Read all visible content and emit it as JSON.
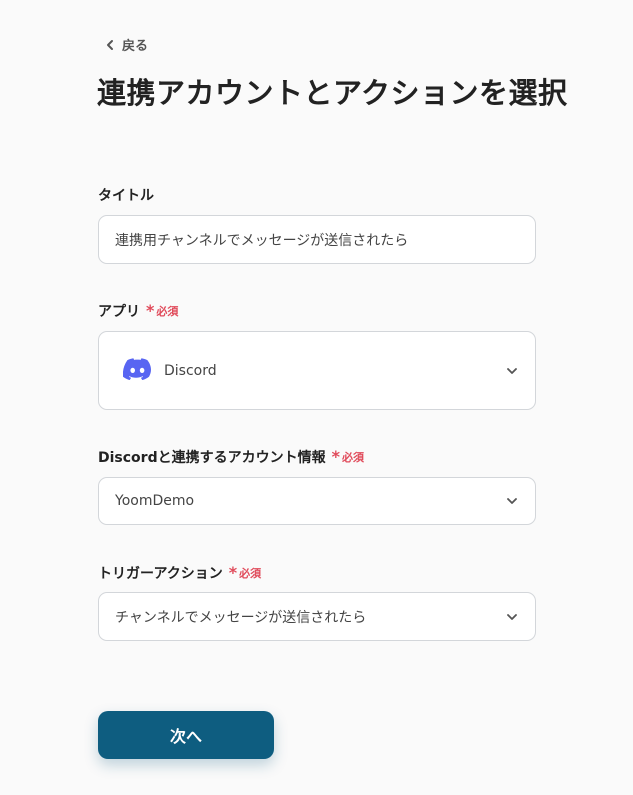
{
  "back_label": "戻る",
  "page_title": "連携アカウントとアクションを選択",
  "required_label": "必須",
  "required_mark": "*",
  "fields": {
    "title": {
      "label": "タイトル",
      "value": "連携用チャンネルでメッセージが送信されたら"
    },
    "app": {
      "label": "アプリ",
      "value": "Discord",
      "icon": "discord-logo"
    },
    "account": {
      "label": "Discordと連携するアカウント情報",
      "value": "YoomDemo"
    },
    "trigger": {
      "label": "トリガーアクション",
      "value": "チャンネルでメッセージが送信されたら"
    }
  },
  "next_button_label": "次へ",
  "colors": {
    "primary": "#0e5d80",
    "required": "#e04a5a",
    "discord": "#5865f2"
  }
}
